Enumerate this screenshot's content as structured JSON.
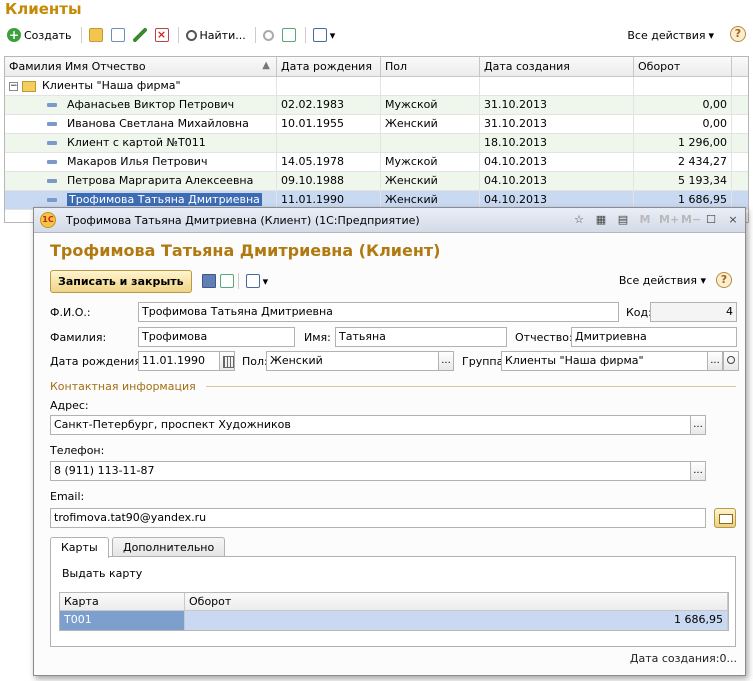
{
  "list": {
    "title": "Клиенты",
    "toolbar": {
      "create_label": "Создать",
      "find_label": "Найти...",
      "all_actions_label": "Все действия",
      "help_label": "?"
    },
    "columns": [
      "Фамилия Имя Отчество",
      "Дата рождения",
      "Пол",
      "Дата создания",
      "Оборот"
    ],
    "group_row": {
      "name": "Клиенты \"Наша фирма\""
    },
    "rows": [
      {
        "name": "Афанасьев Виктор Петрович",
        "birth": "02.02.1983",
        "sex": "Мужской",
        "created": "31.10.2013",
        "turnover": "0,00"
      },
      {
        "name": "Иванова Светлана Михайловна",
        "birth": "10.01.1955",
        "sex": "Женский",
        "created": "31.10.2013",
        "turnover": "0,00"
      },
      {
        "name": "Клиент с картой №Т011",
        "birth": "",
        "sex": "",
        "created": "18.10.2013",
        "turnover": "1 296,00"
      },
      {
        "name": "Макаров Илья Петрович",
        "birth": "14.05.1978",
        "sex": "Мужской",
        "created": "04.10.2013",
        "turnover": "2 434,27"
      },
      {
        "name": "Петрова Маргарита Алексеевна",
        "birth": "09.10.1988",
        "sex": "Женский",
        "created": "04.10.2013",
        "turnover": "5 193,34"
      },
      {
        "name": "Трофимова Татьяна Дмитриевна",
        "birth": "11.01.1990",
        "sex": "Женский",
        "created": "04.10.2013",
        "turnover": "1 686,95"
      }
    ]
  },
  "window": {
    "title": "Трофимова Татьяна Дмитриевна (Клиент)  (1С:Предприятие)",
    "logo_text": "1С",
    "ctrl_m": "M",
    "ctrl_mplus": "M+",
    "ctrl_mminus": "M−",
    "ctrl_close": "×"
  },
  "form": {
    "title": "Трофимова Татьяна Дмитриевна (Клиент)",
    "save_close_label": "Записать и закрыть",
    "all_actions_label": "Все действия",
    "help_label": "?",
    "fio_label": "Ф.И.О.:",
    "fio_value": "Трофимова Татьяна Дмитриевна",
    "code_label": "Код:",
    "code_value": "4",
    "surname_label": "Фамилия:",
    "surname_value": "Трофимова",
    "name_label": "Имя:",
    "name_value": "Татьяна",
    "patronymic_label": "Отчество:",
    "patronymic_value": "Дмитриевна",
    "birth_label": "Дата рождения:",
    "birth_value": "11.01.1990",
    "sex_label": "Пол:",
    "sex_value": "Женский",
    "group_label": "Группа:",
    "group_value": "Клиенты \"Наша фирма\"",
    "contact_group_label": "Контактная информация",
    "address_label": "Адрес:",
    "address_value": "Санкт-Петербург, проспект Художников",
    "phone_label": "Телефон:",
    "phone_value": "8 (911) 113-11-87",
    "email_label": "Email:",
    "email_value": "trofimova.tat90@yandex.ru",
    "dots": "...",
    "tabs": [
      "Карты",
      "Дополнительно"
    ],
    "issue_card_label": "Выдать карту",
    "cards_columns": [
      "Карта",
      "Оборот"
    ],
    "cards_rows": [
      {
        "card": "Т001",
        "turnover": "1 686,95"
      }
    ],
    "created_at_label": "Дата создания:0..."
  }
}
